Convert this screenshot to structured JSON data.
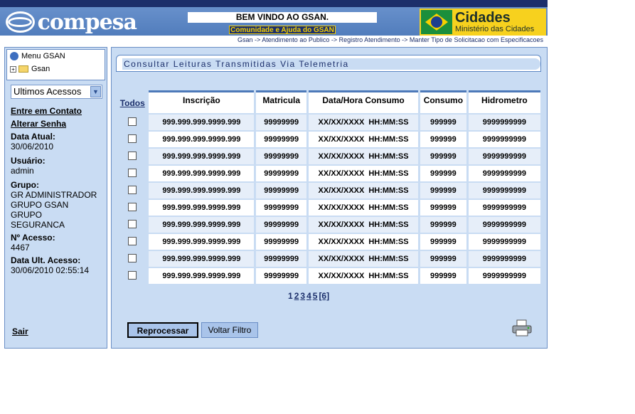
{
  "header": {
    "logo_text": "compesa",
    "welcome": "BEM VINDO AO GSAN.",
    "community": "Comunidade e Ajuda do GSAN",
    "cidades_title": "Cidades",
    "cidades_sub": "Ministério das Cidades",
    "breadcrumb": "Gsan -> Atendimento ao Publico -> Registro Atendimento -> Manter Tipo de Solicitacao com Especificacoes"
  },
  "sidebar": {
    "menu_title": "Menu GSAN",
    "menu_item": "Gsan",
    "select_value": "Ultimos Acessos",
    "contact_link": "Entre em Contato",
    "password_link": "Alterar Senha",
    "date_label": "Data Atual:",
    "date_value": "30/06/2010",
    "user_label": "Usuário:",
    "user_value": "admin",
    "group_label": "Grupo:",
    "group_lines": [
      "GR ADMINISTRADOR",
      "GRUPO GSAN",
      "GRUPO",
      "SEGURANCA"
    ],
    "access_label": "Nº Acesso:",
    "access_value": "4467",
    "last_access_label": "Data Ult. Acesso:",
    "last_access_value": "30/06/2010 02:55:14",
    "logout": "Sair"
  },
  "main": {
    "title": "Consultar Leituras Transmitidas Via Telemetria",
    "columns": {
      "todos": "Todos",
      "inscricao": "Inscrição",
      "matricula": "Matricula",
      "datahora": "Data/Hora Consumo",
      "consumo": "Consumo",
      "hidrometro": "Hidrometro"
    },
    "rows": [
      {
        "inscricao": "999.999.999.9999.999",
        "matricula": "99999999",
        "data": "XX/XX/XXXX",
        "hora": "HH:MM:SS",
        "consumo": "999999",
        "hidrometro": "9999999999"
      },
      {
        "inscricao": "999.999.999.9999.999",
        "matricula": "99999999",
        "data": "XX/XX/XXXX",
        "hora": "HH:MM:SS",
        "consumo": "999999",
        "hidrometro": "9999999999"
      },
      {
        "inscricao": "999.999.999.9999.999",
        "matricula": "99999999",
        "data": "XX/XX/XXXX",
        "hora": "HH:MM:SS",
        "consumo": "999999",
        "hidrometro": "9999999999"
      },
      {
        "inscricao": "999.999.999.9999.999",
        "matricula": "99999999",
        "data": "XX/XX/XXXX",
        "hora": "HH:MM:SS",
        "consumo": "999999",
        "hidrometro": "9999999999"
      },
      {
        "inscricao": "999.999.999.9999.999",
        "matricula": "99999999",
        "data": "XX/XX/XXXX",
        "hora": "HH:MM:SS",
        "consumo": "999999",
        "hidrometro": "9999999999"
      },
      {
        "inscricao": "999.999.999.9999.999",
        "matricula": "99999999",
        "data": "XX/XX/XXXX",
        "hora": "HH:MM:SS",
        "consumo": "999999",
        "hidrometro": "9999999999"
      },
      {
        "inscricao": "999.999.999.9999.999",
        "matricula": "99999999",
        "data": "XX/XX/XXXX",
        "hora": "HH:MM:SS",
        "consumo": "999999",
        "hidrometro": "9999999999"
      },
      {
        "inscricao": "999.999.999.9999.999",
        "matricula": "99999999",
        "data": "XX/XX/XXXX",
        "hora": "HH:MM:SS",
        "consumo": "999999",
        "hidrometro": "9999999999"
      },
      {
        "inscricao": "999.999.999.9999.999",
        "matricula": "99999999",
        "data": "XX/XX/XXXX",
        "hora": "HH:MM:SS",
        "consumo": "999999",
        "hidrometro": "9999999999"
      },
      {
        "inscricao": "999.999.999.9999.999",
        "matricula": "99999999",
        "data": "XX/XX/XXXX",
        "hora": "HH:MM:SS",
        "consumo": "999999",
        "hidrometro": "9999999999"
      }
    ],
    "pager": {
      "pages": [
        "1",
        "2",
        "3",
        "4",
        "5"
      ],
      "last": "[6]"
    },
    "buttons": {
      "reprocessar": "Reprocessar",
      "voltar": "Voltar Filtro"
    }
  },
  "icons": {
    "printer": "printer-icon",
    "user": "user-icon",
    "folder": "folder-icon"
  }
}
